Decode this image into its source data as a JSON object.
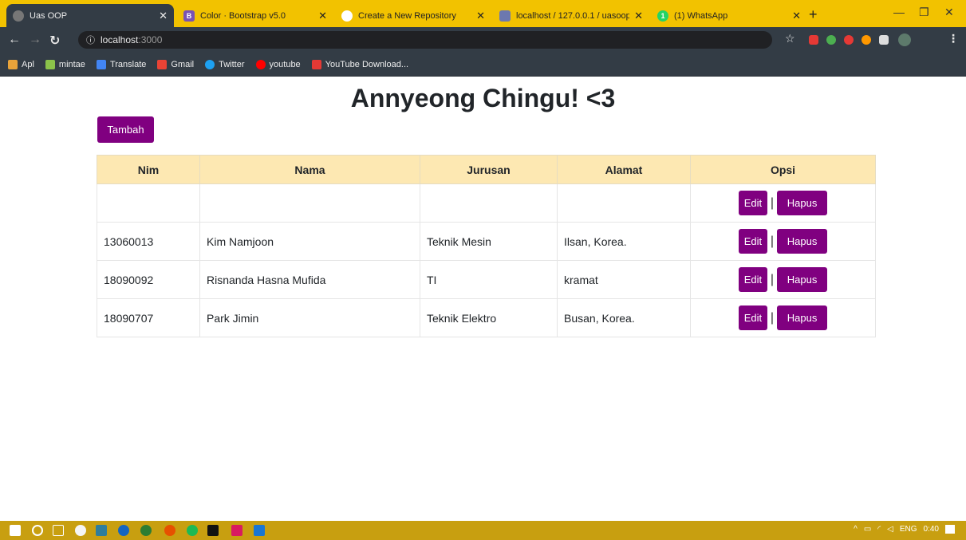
{
  "tabs": [
    {
      "label": "Uas OOP",
      "active": true,
      "icon": "globe-icon"
    },
    {
      "label": "Color · Bootstrap v5.0",
      "icon": "bootstrap-icon"
    },
    {
      "label": "Create a New Repository",
      "icon": "github-icon"
    },
    {
      "label": "localhost / 127.0.0.1 / uasoop",
      "icon": "phpmyadmin-icon"
    },
    {
      "label": "(1) WhatsApp",
      "icon": "whatsapp-icon"
    }
  ],
  "address": {
    "host": "localhost",
    "port": ":3000"
  },
  "bookmarks": [
    {
      "label": "Apl",
      "icon": "apps-icon",
      "color": "#e8a33a"
    },
    {
      "label": "mintae",
      "icon": "mintae-icon",
      "color": "#8bc34a"
    },
    {
      "label": "Translate",
      "icon": "translate-icon",
      "color": "#4285f4"
    },
    {
      "label": "Gmail",
      "icon": "gmail-icon",
      "color": "#ea4335"
    },
    {
      "label": "Twitter",
      "icon": "twitter-icon",
      "color": "#1da1f2"
    },
    {
      "label": "youtube",
      "icon": "youtube-icon",
      "color": "#ff0000"
    },
    {
      "label": "YouTube Download...",
      "icon": "download-icon",
      "color": "#e53935"
    }
  ],
  "page": {
    "title": "Annyeong Chingu! <3",
    "add_button": "Tambah",
    "table": {
      "headers": [
        "Nim",
        "Nama",
        "Jurusan",
        "Alamat",
        "Opsi"
      ],
      "rows": [
        {
          "nim": "",
          "nama": "",
          "jurusan": "",
          "alamat": ""
        },
        {
          "nim": "13060013",
          "nama": "Kim Namjoon",
          "jurusan": "Teknik Mesin",
          "alamat": "Ilsan, Korea."
        },
        {
          "nim": "18090092",
          "nama": "Risnanda Hasna Mufida",
          "jurusan": "TI",
          "alamat": "kramat"
        },
        {
          "nim": "18090707",
          "nama": "Park Jimin",
          "jurusan": "Teknik Elektro",
          "alamat": "Busan, Korea."
        }
      ],
      "edit_label": "Edit",
      "delete_label": "Hapus",
      "separator": "|"
    }
  },
  "taskbar": {
    "language": "ENG",
    "time": "0:40"
  },
  "colors": {
    "accent": "#800080",
    "header_bg": "#fde8b2",
    "tab_strip": "#f2c200",
    "taskbar": "#c89f10"
  }
}
